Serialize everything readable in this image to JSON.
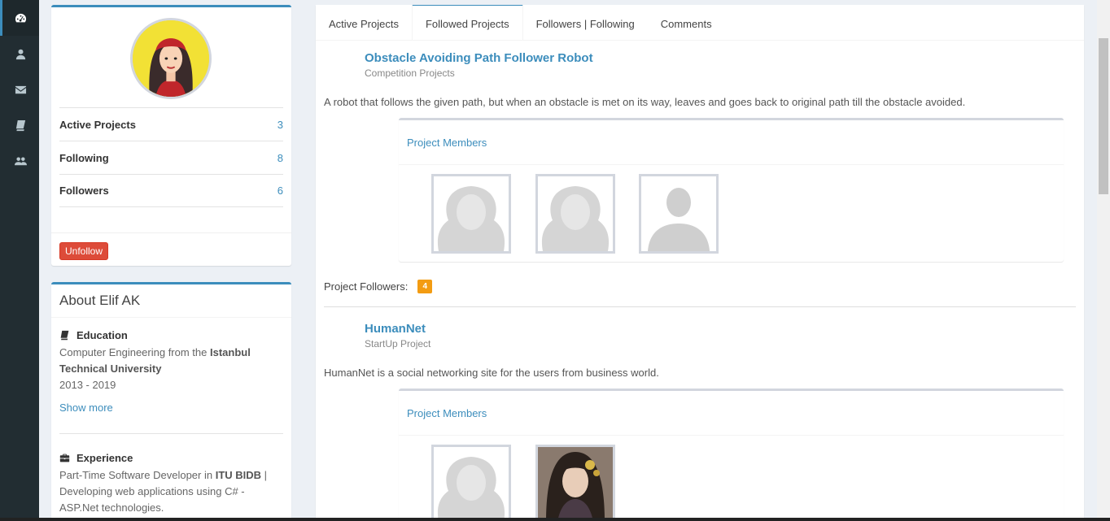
{
  "sidebar": {
    "icons": [
      "dashboard-icon",
      "user-icon",
      "envelope-icon",
      "book-icon",
      "users-icon"
    ]
  },
  "profile": {
    "stats": [
      {
        "label": "Active Projects",
        "value": "3"
      },
      {
        "label": "Following",
        "value": "8"
      },
      {
        "label": "Followers",
        "value": "6"
      }
    ],
    "unfollow_label": "Unfollow"
  },
  "about": {
    "title": "About Elif AK",
    "education": {
      "heading": "Education",
      "text_prefix": "Computer Engineering from the ",
      "university": "Istanbul Technical University",
      "years": "2013 - 2019",
      "show_more": "Show more"
    },
    "experience": {
      "heading": "Experience",
      "text_prefix": "Part-Time Software Developer in ",
      "org": "ITU BIDB",
      "text_suffix": " | Developing web applications using C# - ASP.Net technologies."
    }
  },
  "tabs": [
    {
      "label": "Active Projects",
      "active": false
    },
    {
      "label": "Followed Projects",
      "active": true
    },
    {
      "label": "Followers | Following",
      "active": false
    },
    {
      "label": "Comments",
      "active": false
    }
  ],
  "projects": [
    {
      "title": "Obstacle Avoiding Path Follower Robot",
      "category": "Competition Projects",
      "description": "A robot that follows the given path, but when an obstacle is met on its way, leaves and goes back to original path till the obstacle avoided.",
      "members_title": "Project Members",
      "members": [
        "female-silhouette",
        "female-silhouette",
        "male-silhouette"
      ],
      "followers_label": "Project Followers:",
      "followers_count": "4"
    },
    {
      "title": "HumanNet",
      "category": "StartUp Project",
      "description": "HumanNet is a social networking site for the users from business world.",
      "members_title": "Project Members",
      "members": [
        "female-silhouette",
        "portrait-photo"
      ]
    }
  ],
  "colors": {
    "primary": "#3c8dbc",
    "danger": "#dd4b39",
    "warning": "#f39c12",
    "sidebar_bg": "#222d32"
  }
}
